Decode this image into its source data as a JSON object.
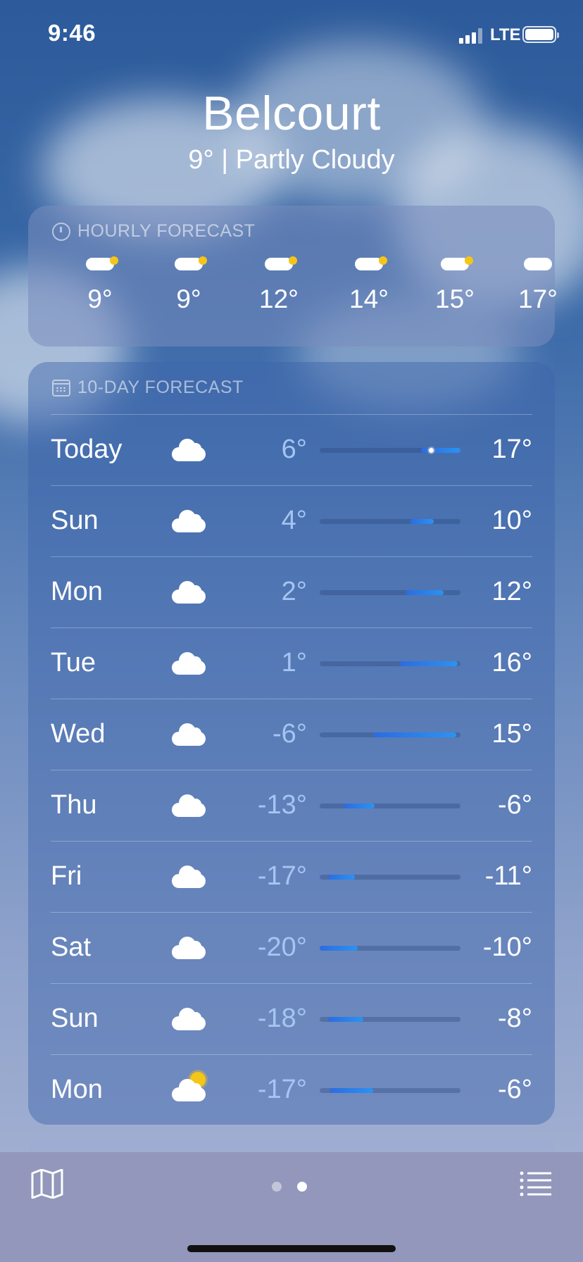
{
  "status_bar": {
    "time": "9:46",
    "network": "LTE"
  },
  "location": {
    "city": "Belcourt",
    "current": "9°  |  Partly Cloudy"
  },
  "hourly": {
    "title": "HOURLY FORECAST",
    "items": [
      {
        "temp": "9°",
        "icon": "partly-cloudy-icon"
      },
      {
        "temp": "9°",
        "icon": "partly-cloudy-icon"
      },
      {
        "temp": "12°",
        "icon": "partly-cloudy-icon"
      },
      {
        "temp": "14°",
        "icon": "partly-cloudy-icon"
      },
      {
        "temp": "15°",
        "icon": "partly-cloudy-icon"
      },
      {
        "temp": "17°",
        "icon": "cloud-icon"
      }
    ]
  },
  "ten_day": {
    "title": "10-DAY FORECAST",
    "days": [
      {
        "day": "Today",
        "icon": "cloud-icon",
        "low": "6°",
        "high": "17°",
        "range_start": 0.72,
        "range_end": 1.0,
        "current_pos": 0.79
      },
      {
        "day": "Sun",
        "icon": "cloud-icon",
        "low": "4°",
        "high": "10°",
        "range_start": 0.64,
        "range_end": 0.81,
        "current_pos": null
      },
      {
        "day": "Mon",
        "icon": "cloud-icon",
        "low": "2°",
        "high": "12°",
        "range_start": 0.61,
        "range_end": 0.88,
        "current_pos": null
      },
      {
        "day": "Tue",
        "icon": "cloud-icon",
        "low": "1°",
        "high": "16°",
        "range_start": 0.57,
        "range_end": 0.98,
        "current_pos": null
      },
      {
        "day": "Wed",
        "icon": "cloud-icon",
        "low": "-6°",
        "high": "15°",
        "range_start": 0.38,
        "range_end": 0.97,
        "current_pos": null
      },
      {
        "day": "Thu",
        "icon": "cloud-icon",
        "low": "-13°",
        "high": "-6°",
        "range_start": 0.17,
        "range_end": 0.39,
        "current_pos": null
      },
      {
        "day": "Fri",
        "icon": "cloud-icon",
        "low": "-17°",
        "high": "-11°",
        "range_start": 0.06,
        "range_end": 0.25,
        "current_pos": null
      },
      {
        "day": "Sat",
        "icon": "cloud-icon",
        "low": "-20°",
        "high": "-10°",
        "range_start": 0.0,
        "range_end": 0.27,
        "current_pos": null
      },
      {
        "day": "Sun",
        "icon": "cloud-icon",
        "low": "-18°",
        "high": "-8°",
        "range_start": 0.06,
        "range_end": 0.31,
        "current_pos": null
      },
      {
        "day": "Mon",
        "icon": "partly-sunny-icon",
        "low": "-17°",
        "high": "-6°",
        "range_start": 0.07,
        "range_end": 0.38,
        "current_pos": null
      }
    ]
  },
  "toolbar": {
    "active_page": 2,
    "page_count": 2
  },
  "colors": {
    "bar_start": "#2c6ce0",
    "bar_end": "#2b93f0",
    "sun": "#f5c518"
  }
}
